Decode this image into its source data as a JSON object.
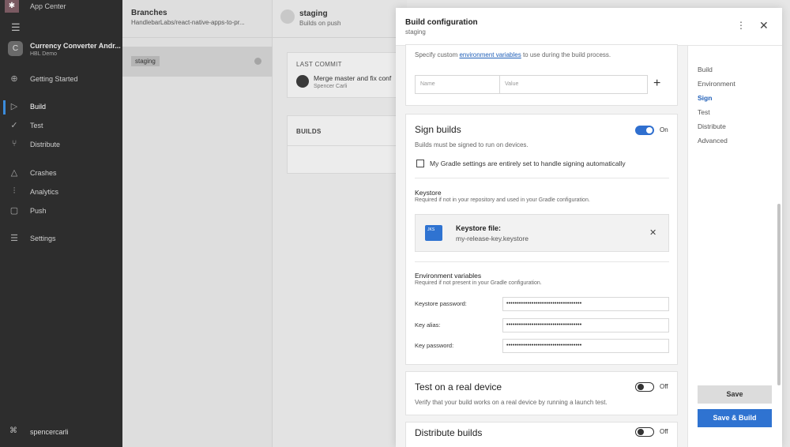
{
  "nav": {
    "app_center_label": "App Center",
    "app_name": "Currency Converter Andr...",
    "app_sub": "HBL Demo",
    "avatar_letter": "C",
    "items": [
      {
        "label": "Getting Started",
        "icon": "rocket-icon"
      },
      {
        "label": "Build",
        "icon": "play-icon",
        "active": true
      },
      {
        "label": "Test",
        "icon": "check-circle-icon"
      },
      {
        "label": "Distribute",
        "icon": "distribute-icon"
      },
      {
        "label": "Crashes",
        "icon": "warning-icon"
      },
      {
        "label": "Analytics",
        "icon": "chart-icon"
      },
      {
        "label": "Push",
        "icon": "push-icon"
      },
      {
        "label": "Settings",
        "icon": "sliders-icon"
      }
    ],
    "user": "spencercarli"
  },
  "branches": {
    "title": "Branches",
    "path": "HandlebarLabs/react-native-apps-to-pr...",
    "items": [
      {
        "label": "staging"
      }
    ]
  },
  "staging": {
    "title": "staging",
    "subtitle": "Builds on push",
    "last_commit_label": "LAST COMMIT",
    "commit_message": "Merge master and fix conf",
    "commit_author": "Spencer Carli",
    "builds_label": "BUILDS"
  },
  "panel": {
    "title": "Build configuration",
    "subtitle": "staging",
    "env": {
      "desc_prefix": "Specify custom ",
      "desc_link": "environment variables",
      "desc_suffix": " to use during the build process.",
      "name_placeholder": "Name",
      "value_placeholder": "Value"
    },
    "sign": {
      "title": "Sign builds",
      "toggle_label": "On",
      "toggle_on": true,
      "desc": "Builds must be signed to run on devices.",
      "checkbox_label": "My Gradle settings are entirely set to handle signing automatically",
      "keystore_title": "Keystore",
      "keystore_desc": "Required if not in your repository and used in your Gradle configuration.",
      "keystore_file_label": "Keystore file:",
      "keystore_file_name": "my-release-key.keystore",
      "file_icon_text": "JKS",
      "env_title": "Environment variables",
      "env_desc": "Required if not present in your Gradle configuration.",
      "fields": [
        {
          "label": "Keystore password:",
          "value": "••••••••••••••••••••••••••••••••••••"
        },
        {
          "label": "Key alias:",
          "value": "••••••••••••••••••••••••••••••••••••"
        },
        {
          "label": "Key password:",
          "value": "••••••••••••••••••••••••••••••••••••"
        }
      ]
    },
    "test": {
      "title": "Test on a real device",
      "toggle_label": "Off",
      "desc": "Verify that your build works on a real device by running a launch test."
    },
    "distribute": {
      "title": "Distribute builds",
      "toggle_label": "Off"
    },
    "side_nav": [
      "Build",
      "Environment",
      "Sign",
      "Test",
      "Distribute",
      "Advanced"
    ],
    "side_nav_selected": "Sign",
    "save_label": "Save",
    "save_build_label": "Save & Build"
  },
  "colors": {
    "accent": "#2f73d1",
    "nav_bg": "#2d2d2d"
  }
}
